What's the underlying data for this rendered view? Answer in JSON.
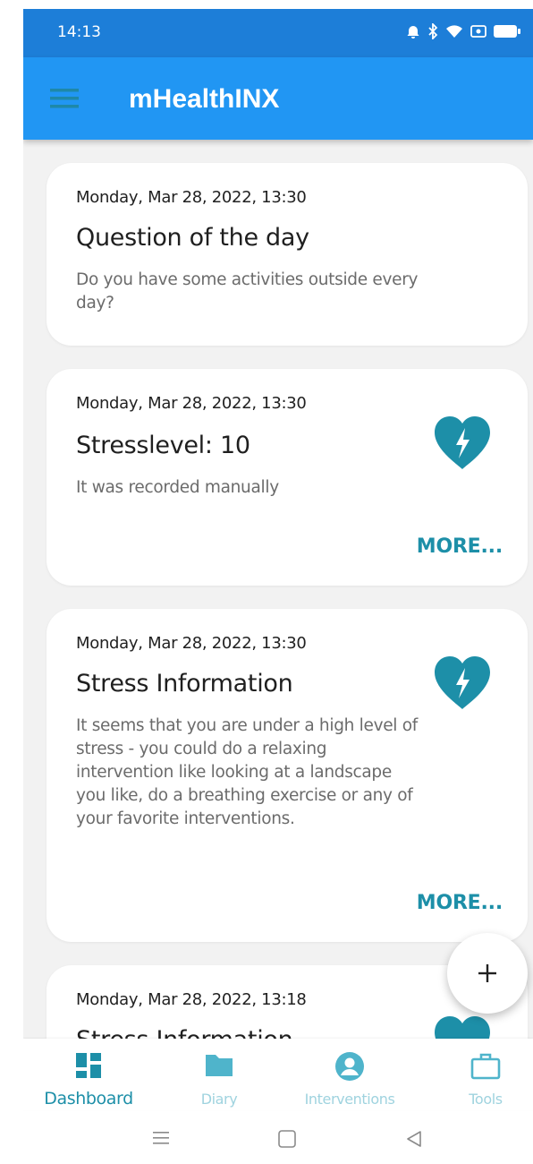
{
  "status_bar": {
    "time": "14:13"
  },
  "app_bar": {
    "title": "mHealthINX"
  },
  "cards": [
    {
      "date": "Monday, Mar 28, 2022, 13:30",
      "title": "Question of the day",
      "text": "Do you have some activities outside every day?"
    },
    {
      "date": "Monday, Mar 28, 2022, 13:30",
      "title": "Stresslevel: 10",
      "text": "It was recorded manually",
      "more": "MORE..."
    },
    {
      "date": "Monday, Mar 28, 2022, 13:30",
      "title": "Stress Information",
      "text": "It seems that you are under a high level of stress - you could do a relaxing intervention like looking at a landscape you like, do a breathing exercise or any of your favorite interventions.",
      "more": "MORE..."
    },
    {
      "date": "Monday, Mar 28, 2022, 13:18",
      "title": "Stress Information"
    }
  ],
  "fab": {
    "label": "+"
  },
  "bottom_nav": [
    {
      "label": "Dashboard",
      "icon": "dashboard-icon",
      "active": true
    },
    {
      "label": "Diary",
      "icon": "folder-icon",
      "active": false
    },
    {
      "label": "Interventions",
      "icon": "account-circle-icon",
      "active": false
    },
    {
      "label": "Tools",
      "icon": "briefcase-icon",
      "active": false
    }
  ],
  "colors": {
    "primary": "#2196f3",
    "status_bar": "#1d7ed8",
    "accent": "#1d8fa8",
    "background": "#f2f2f2"
  }
}
